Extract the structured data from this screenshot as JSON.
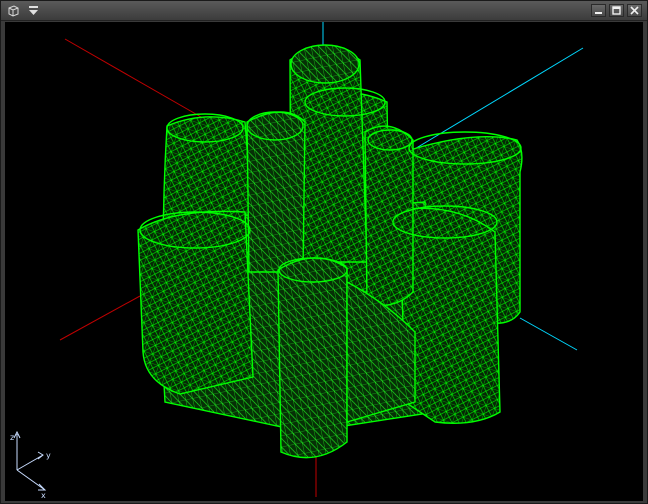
{
  "window": {
    "title": "",
    "icons": [
      "cube-icon",
      "dropdown-menu-icon"
    ],
    "controls": [
      "minimize-icon",
      "maximize-icon",
      "close-icon"
    ]
  },
  "viewport": {
    "background": "#000000",
    "mesh_color": "#00ff00",
    "render_mode": "wireframe",
    "axes_colors": {
      "red_axis": "#c00000",
      "cyan_axis": "#00d8ff"
    },
    "triad": {
      "labels": [
        "z",
        "y",
        "x"
      ],
      "color": "#c8dcff"
    }
  }
}
